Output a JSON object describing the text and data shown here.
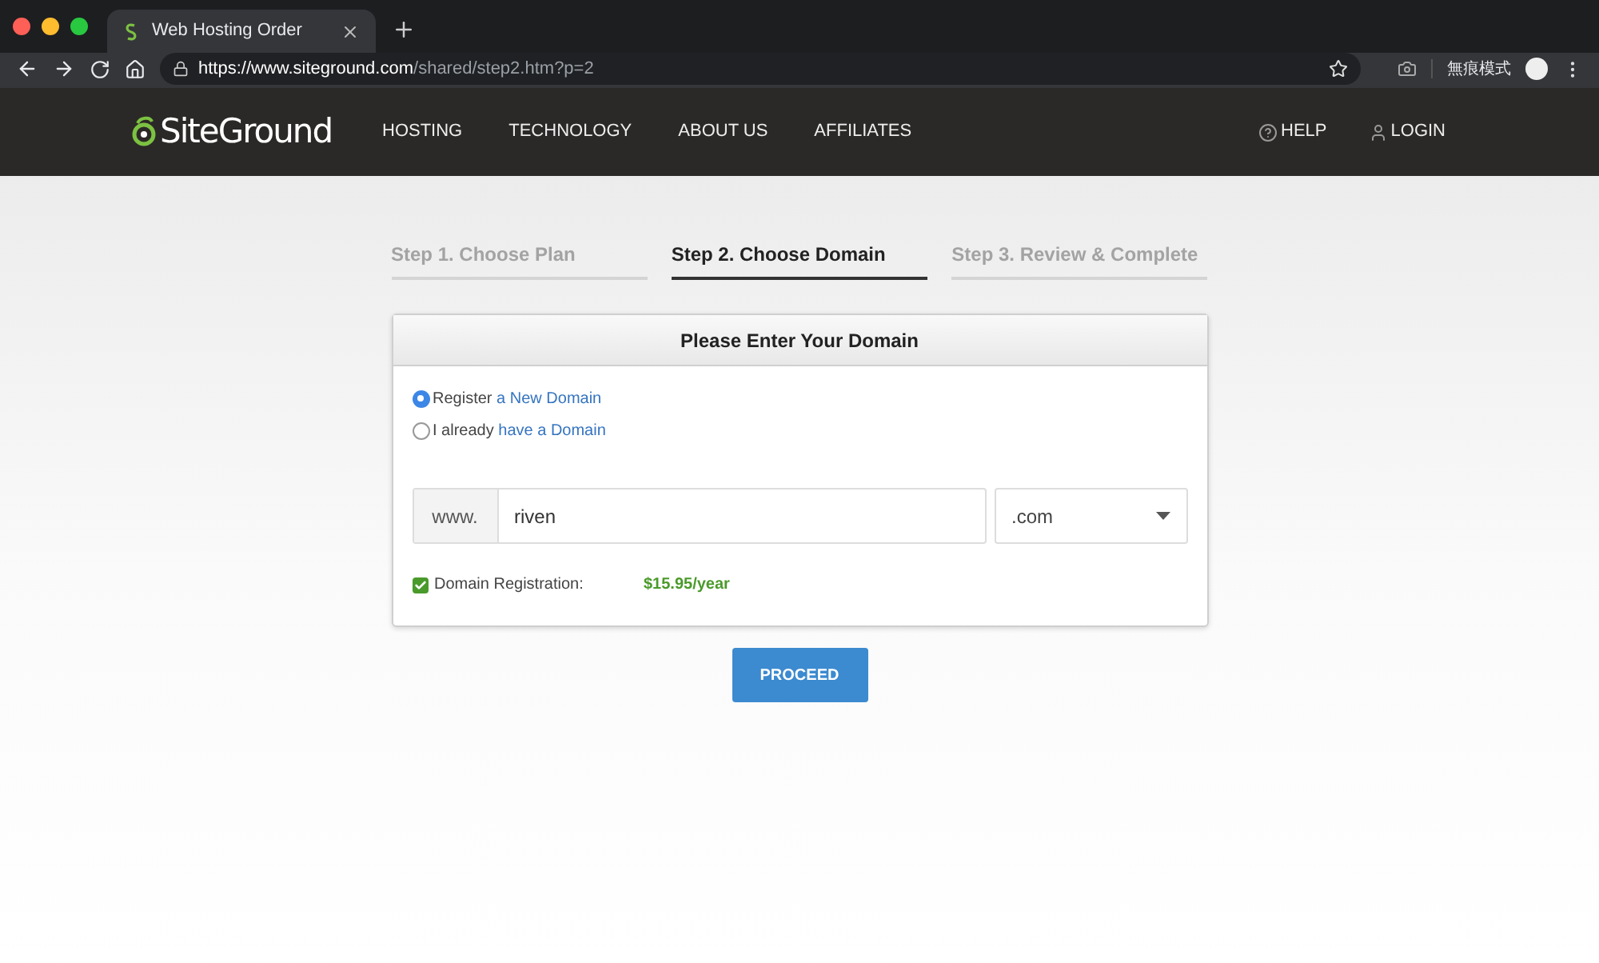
{
  "browser": {
    "tab_title": "Web Hosting Order",
    "url_host": "https://www.siteground.com",
    "url_path": "/shared/step2.htm?p=2",
    "incognito_label": "無痕模式"
  },
  "header": {
    "logo": "SiteGround",
    "nav": [
      "HOSTING",
      "TECHNOLOGY",
      "ABOUT US",
      "AFFILIATES"
    ],
    "help": "HELP",
    "login": "LOGIN"
  },
  "steps": [
    {
      "label": "Step 1. Choose Plan",
      "selected": false
    },
    {
      "label": "Step 2. Choose Domain",
      "selected": true
    },
    {
      "label": "Step 3. Review & Complete",
      "selected": false
    }
  ],
  "card": {
    "title": "Please Enter Your Domain",
    "options": [
      {
        "text": "Register",
        "link": "a New Domain",
        "selected": true
      },
      {
        "text": "I already",
        "link": "have a Domain",
        "selected": false
      }
    ],
    "prefix": "www.",
    "domain": "riven",
    "tld": ".com",
    "registration": {
      "label": "Domain Registration:",
      "price": "$15.95/year",
      "checked": true
    }
  },
  "proceed": "PROCEED"
}
